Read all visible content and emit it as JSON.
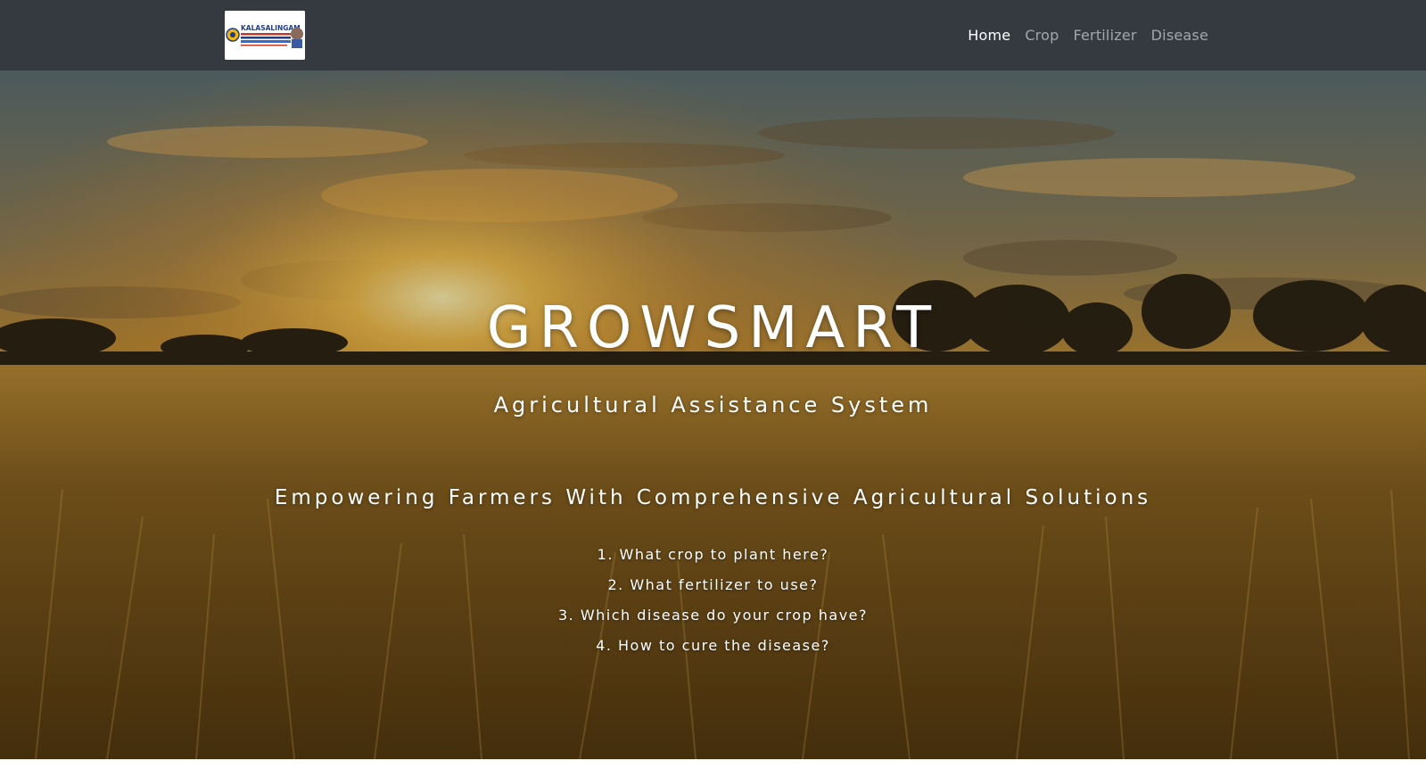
{
  "logo": {
    "text": "KALASALINGAM"
  },
  "nav": {
    "items": [
      {
        "label": "Home",
        "active": true
      },
      {
        "label": "Crop",
        "active": false
      },
      {
        "label": "Fertilizer",
        "active": false
      },
      {
        "label": "Disease",
        "active": false
      }
    ]
  },
  "hero": {
    "title": "GROWSMART",
    "subtitle": "Agricultural Assistance System",
    "tagline": "Empowering Farmers With Comprehensive Agricultural Solutions",
    "questions": [
      "1. What crop to plant here?",
      "2. What fertilizer to use?",
      "3. Which disease do your crop have?",
      "4. How to cure the disease?"
    ]
  },
  "colors": {
    "navbar": "#343a40",
    "nav_active": "#ffffff",
    "nav_inactive": "rgba(255,255,255,0.55)",
    "sky_top": "#5f6e72",
    "sun": "#f6c04a",
    "field": "#7a5414"
  }
}
